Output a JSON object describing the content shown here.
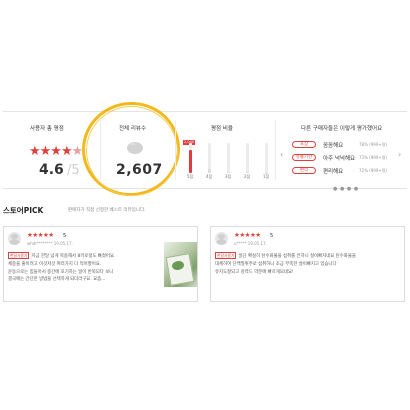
{
  "summary": {
    "rating_title": "사용자 총 평점",
    "stars_full": "★★★★",
    "stars_part": "★",
    "avg_score": "4.6",
    "avg_max": "/5",
    "total_title": "전체 리뷰수",
    "total_count": "2,607",
    "dist_title": "평점 비율",
    "dist_badge": "2,040",
    "dist_bars": [
      {
        "label": "5점",
        "fraction": 0.78
      },
      {
        "label": "4점",
        "fraction": 0.15
      },
      {
        "label": "3점",
        "fraction": 0.04
      },
      {
        "label": "2점",
        "fraction": 0.02
      },
      {
        "label": "1점",
        "fraction": 0.01
      }
    ],
    "eval_title": "다른 구매자들은 이렇게 평가했어요",
    "eval_rows": [
      {
        "tag": "포장",
        "value": "꼼꼼해요",
        "pct": "78% (999+명)"
      },
      {
        "tag": "유통기한",
        "value": "아주 넉넉해요",
        "pct": "73% (999+명)"
      },
      {
        "tag": "편리",
        "value": "편리해요",
        "pct": "72% (999+명)"
      }
    ],
    "prev_arrow": "‹",
    "next_arrow": "›",
    "page_dots": "● ● ● ●"
  },
  "pick": {
    "title": "스토어PICK",
    "subtitle": "판매자가 직접 선정한 베스트 리뷰입니다.",
    "reviews": [
      {
        "stars": "★★★★★",
        "score": "5",
        "user": "whdl********  19.05.17.",
        "badge": "한달사용기",
        "lines": [
          "지금 한달 넘게 복용해서 8키로정도 빠졌어요.",
          "체중을 줄이려고 이것저것 여러가지 다 먹어봤어요.",
          "운동으로는 힘들어서 중간에 포기하는 일이 반복되다 보니",
          "결국에는 간단한 방법을 선택하게 되더라구요. 요즘..."
        ]
      },
      {
        "stars": "★★★★★",
        "score": "5",
        "user": "u*****  19.05.17.",
        "badge": "한달사용기",
        "lines": [
          "일단 확실히 탄수화물을 섭취를 안하니 살이빠지네요 탄수화물을",
          "대체하여 단백질위주로 섭취하니 조금 부족한 살이빠지고 있습니다",
          "유지도잘되고 강력드 약분에 빠르게되네요!"
        ]
      }
    ]
  }
}
